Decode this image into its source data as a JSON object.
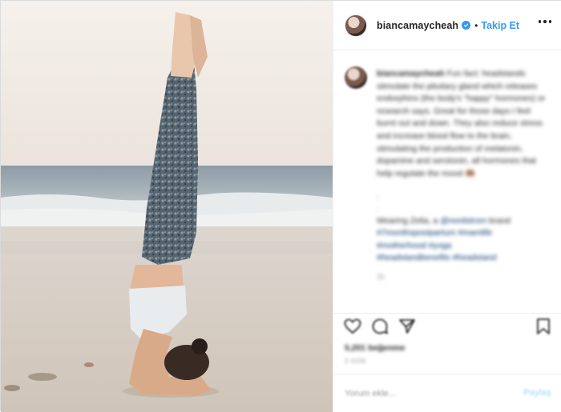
{
  "post": {
    "username": "biancamaycheah",
    "follow_label": "Takip Et",
    "photo_alt": "Woman doing a headstand on the beach by the sea",
    "caption": {
      "username": "biancamaycheah",
      "text": "Fun fact: headstands stimulate the pituitary gland which releases endorphins (the body's \"happy\" hormones) or research says. Great for those days I feel burnt out and down. They also reduce stress and increase blood flow to the brain, stimulating the production of melatonin, dopamine and serotonin, all hormones that help regulate the mood",
      "emoji": "🤲🏽",
      "dots": [
        ".",
        "."
      ],
      "wearing_prefix": "Wearing Zelia, a",
      "wearing_mention": "@nordstrom",
      "wearing_suffix": "brand",
      "hashtags_1": "#7monthspostpartum #mamlife",
      "hashtags_2": "#motherhood #yoga",
      "hashtags_3": "#headstandbenefits #headstand",
      "time": "2h"
    },
    "likes": "5,201 beğenme",
    "date": "2 GÜN",
    "comment_placeholder": "Yorum ekle...",
    "post_button": "Paylaş"
  },
  "icons": {
    "verified": "verified-badge-icon",
    "more": "more-options-icon",
    "like": "heart-icon",
    "comment": "comment-bubble-icon",
    "share": "share-icon",
    "save": "bookmark-icon"
  },
  "colors": {
    "accent": "#3897f0",
    "text": "#262626",
    "muted": "#999999",
    "border": "#efefef",
    "post_button_disabled": "#b2dffc"
  }
}
